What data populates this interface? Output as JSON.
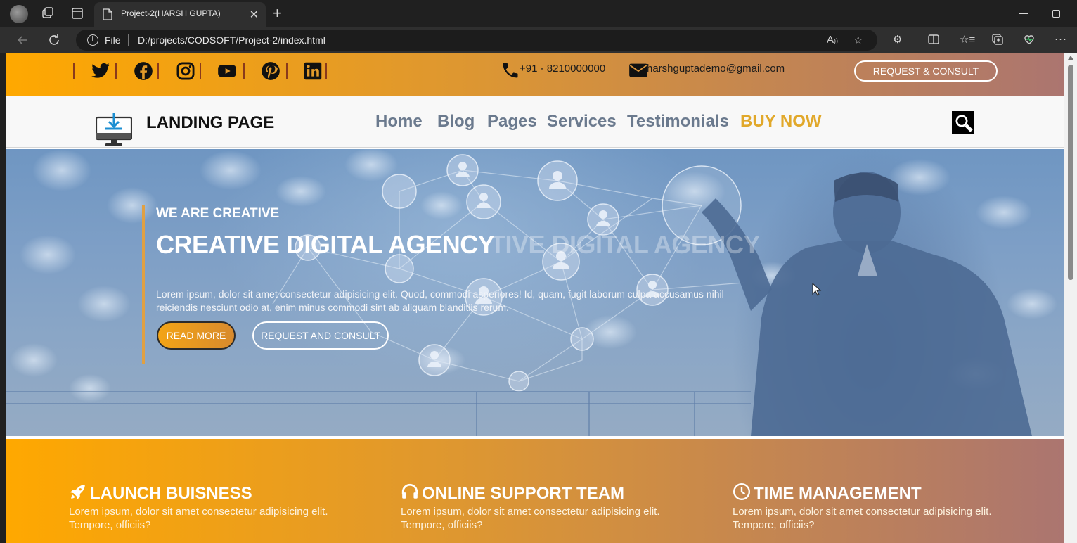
{
  "browser": {
    "tab_title": "Project-2(HARSH GUPTA)",
    "scheme_label": "File",
    "url": "D:/projects/CODSOFT/Project-2/index.html",
    "icons": [
      "profile-avatar",
      "workspaces-icon",
      "tab-actions-icon",
      "page-icon",
      "close-icon",
      "new-tab-icon",
      "back-icon",
      "refresh-icon",
      "info-icon",
      "read-aloud-icon",
      "favorite-star-icon",
      "extensions-icon",
      "split-screen-icon",
      "favorites-icon",
      "collections-icon",
      "browser-essentials-icon",
      "more-icon",
      "minimize-icon",
      "restore-icon"
    ]
  },
  "topbar": {
    "socials": [
      "twitter-icon",
      "facebook-icon",
      "instagram-icon",
      "youtube-icon",
      "pinterest-icon",
      "linkedin-icon"
    ],
    "phone": "+91 - 8210000000",
    "email": "harshguptademo@gmail.com",
    "cta": "REQUEST & CONSULT"
  },
  "navbar": {
    "brand": "LANDING PAGE",
    "links": [
      "Home",
      "Blog",
      "Pages",
      "Services",
      "Testimonials"
    ],
    "buy": "BUY NOW",
    "search_icon": "search-icon"
  },
  "hero": {
    "eyebrow": "WE ARE CREATIVE",
    "title": "CREATIVE DIGITAL AGENCY",
    "title_ghost": "TIVE DIGITAL AGENCY",
    "description": "Lorem ipsum, dolor sit amet consectetur adipisicing elit. Quod, commodi asperiores! Id, quam, fugit laborum culpa accusamus nihil reiciendis nesciunt odio at, enim minus commodi sint ab aliquam blanditiis rerum.",
    "primary_button": "READ MORE",
    "secondary_button": "REQUEST AND CONSULT"
  },
  "features": [
    {
      "icon": "rocket-icon",
      "title": "LAUNCH BUISNESS",
      "desc": "Lorem ipsum, dolor sit amet consectetur adipisicing elit. Tempore, officiis?"
    },
    {
      "icon": "headphones-icon",
      "title": "ONLINE SUPPORT TEAM",
      "desc": "Lorem ipsum, dolor sit amet consectetur adipisicing elit. Tempore, officiis?"
    },
    {
      "icon": "clock-icon",
      "title": "TIME MANAGEMENT",
      "desc": "Lorem ipsum, dolor sit amet consectetur adipisicing elit. Tempore, officiis?"
    }
  ],
  "colors": {
    "gradient_start": "#ffa800",
    "gradient_mid": "#dc9633",
    "gradient_end": "#ab7570",
    "nav_link": "#6b7a8e",
    "buy_now": "#e1a82a",
    "hero_accent": "#e0a043"
  }
}
